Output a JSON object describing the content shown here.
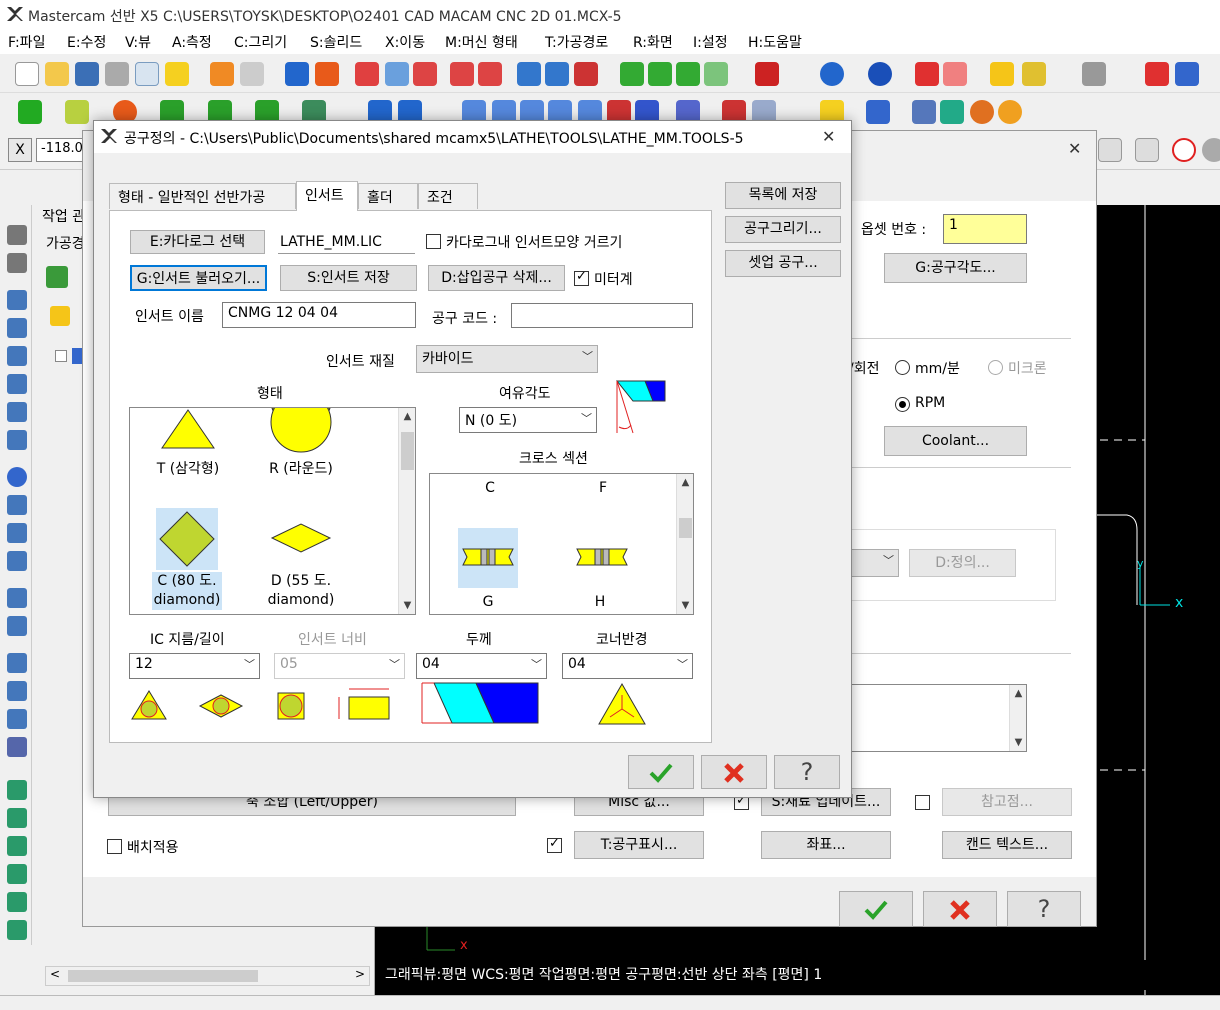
{
  "app": {
    "title": "Mastercam 선반 X5  C:\\USERS\\TOYSK\\DESKTOP\\O2401 CAD MACAM CNC 2D 01.MCX-5"
  },
  "menu": [
    "F:파일",
    "E:수정",
    "V:뷰",
    "A:측정",
    "C:그리기",
    "S:솔리드",
    "X:이동",
    "M:머신 형태",
    "T:가공경로",
    "R:화면",
    "I:설정",
    "H:도움말"
  ],
  "coord": {
    "x_label": "X",
    "x_value": "-118.02"
  },
  "left_panel": {
    "tab_label": "작업 관",
    "row_label": "가공경"
  },
  "status_line": "그래픽뷰:평면   WCS:평면   작업평면:평면   공구평면:선반 상단 좌측 [평면] 1",
  "back_dialog": {
    "offset_label": "옵셋 번호 :",
    "offset_value": "1",
    "tool_angle_btn": "G:공구각도...",
    "rev_label": "/회전",
    "mm_min_label": "mm/분",
    "micron_label": "미크론",
    "rpm_label": "RPM",
    "coolant_btn": "Coolant...",
    "define_btn": "D:정의...",
    "shaft_btn": "축 조합 (Left/Upper)",
    "misc_btn": "Misc 값...",
    "update_btn": "S:재료 업데이트...",
    "ref_btn": "참고점...",
    "batch_label": "배치적용",
    "tool_display_btn": "T:공구표시...",
    "coord_btn": "좌표...",
    "canned_btn": "캔드 텍스트..."
  },
  "dialog": {
    "title": "공구정의 - C:\\Users\\Public\\Documents\\shared mcamx5\\LATHE\\TOOLS\\LATHE_MM.TOOLS-5",
    "tabs": [
      "형태 - 일반적인 선반가공",
      "인서트",
      "홀더",
      "조건"
    ],
    "catalog_btn": "E:카다로그 선택",
    "catalog_file": "LATHE_MM.LIC",
    "filter_label": "카다로그내 인서트모양 거르기",
    "load_insert_btn": "G:인서트 불러오기...",
    "save_insert_btn": "S:인서트 저장",
    "delete_btn": "D:삽입공구 삭제...",
    "metric_label": "미터계",
    "insert_name_label": "인서트 이름",
    "insert_name_value": "CNMG 12 04 04",
    "tool_code_label": "공구 코드 :",
    "tool_code_value": "",
    "material_label": "인서트 재질",
    "material_value": "카바이드",
    "shape_header": "형태",
    "shapes": [
      "T (삼각형)",
      "R (라운드)",
      "C (80 도. diamond)",
      "D (55 도. diamond)"
    ],
    "clearance_header": "여유각도",
    "clearance_value": "N (0 도)",
    "cross_header": "크로스 섹션",
    "cross_items": [
      "C",
      "F",
      "G",
      "H"
    ],
    "ic_label": "IC 지름/길이",
    "ic_value": "12",
    "width_label": "인서트 너비",
    "width_value": "05",
    "thickness_label": "두께",
    "thickness_value": "04",
    "corner_label": "코너반경",
    "corner_value": "04",
    "save_list_btn": "목록에 저장",
    "draw_tool_btn": "공구그리기...",
    "setup_tool_btn": "셋업 공구..."
  },
  "colors": {
    "yellow": "#ffff00",
    "green_shape": "#bfd630",
    "cyan": "#00ffff",
    "blue": "#0000ff",
    "ok_green": "#2aa32a",
    "cancel_red": "#e03020",
    "selection": "#cce4f7"
  }
}
